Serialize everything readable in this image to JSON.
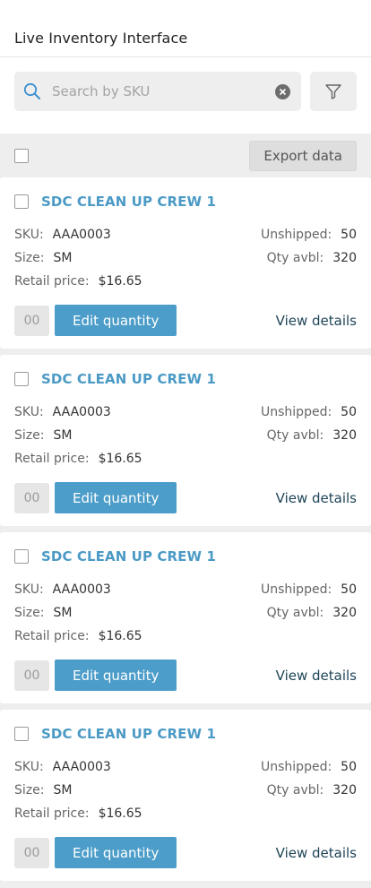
{
  "header": {
    "title": "Live Inventory Interface"
  },
  "search": {
    "placeholder": "Search by SKU",
    "value": ""
  },
  "toolbar": {
    "export_label": "Export data"
  },
  "colors": {
    "accent": "#4c9dc9",
    "title": "#4b9ac5",
    "link": "#1e4457"
  },
  "labels": {
    "sku": "SKU:",
    "size": "Size:",
    "retail": "Retail price:",
    "unshipped": "Unshipped:",
    "qty_avbl": "Qty avbl:",
    "edit": "Edit quantity",
    "view": "View details"
  },
  "items": [
    {
      "title": "SDC CLEAN UP CREW 1",
      "sku": "AAA0003",
      "size": "SM",
      "retail": "$16.65",
      "unshipped": "50",
      "qty_avbl": "320",
      "qty_input": "00"
    },
    {
      "title": "SDC CLEAN UP CREW 1",
      "sku": "AAA0003",
      "size": "SM",
      "retail": "$16.65",
      "unshipped": "50",
      "qty_avbl": "320",
      "qty_input": "00"
    },
    {
      "title": "SDC CLEAN UP CREW 1",
      "sku": "AAA0003",
      "size": "SM",
      "retail": "$16.65",
      "unshipped": "50",
      "qty_avbl": "320",
      "qty_input": "00"
    },
    {
      "title": "SDC CLEAN UP CREW 1",
      "sku": "AAA0003",
      "size": "SM",
      "retail": "$16.65",
      "unshipped": "50",
      "qty_avbl": "320",
      "qty_input": "00"
    }
  ]
}
